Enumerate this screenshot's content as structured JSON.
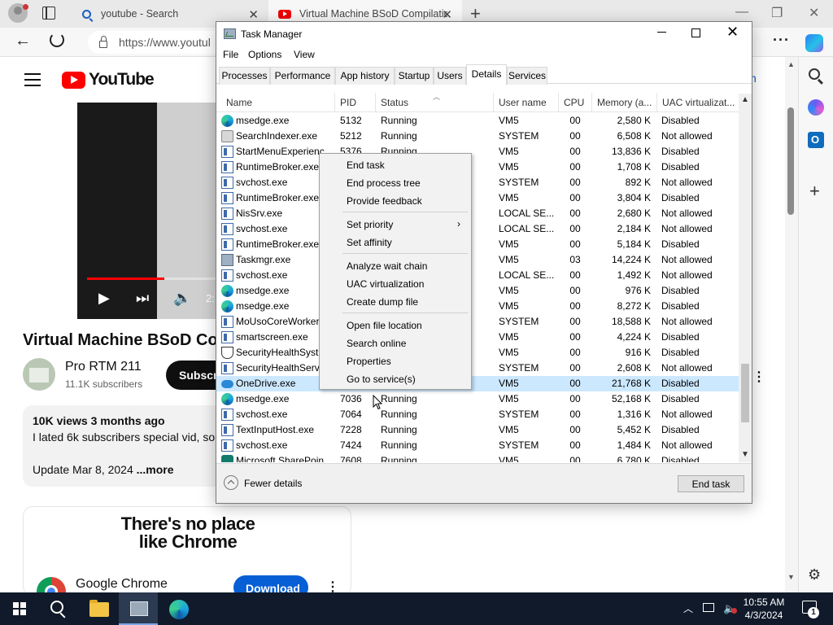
{
  "edge": {
    "tabs": [
      {
        "label": "youtube - Search"
      },
      {
        "label": "Virtual Machine BSoD Compilatio"
      }
    ],
    "new_tab": "+",
    "address": "https://www.youtul"
  },
  "youtube": {
    "logo_text": "YouTube",
    "video_title": "Virtual Machine BSoD Com",
    "time_fragment": "2:",
    "channel_name": "Pro RTM 211",
    "channel_subs": "11.1K subscribers",
    "subscribe_label": "Subscri",
    "views_date": "10K views  3 months ago",
    "description": "I lated 6k subscribers special vid, so",
    "update_text": "Update Mar 8, 2024",
    "more_label": "...more",
    "ad_headline_1": "There's no place",
    "ad_headline_2": "like Chrome",
    "ad_name": "Google Chrome",
    "download_label": "Download",
    "signin_fragment": "n",
    "video_progress": 0.6
  },
  "task_manager": {
    "title": "Task Manager",
    "menu": [
      "File",
      "Options",
      "View"
    ],
    "tabs": [
      {
        "label": "Processes"
      },
      {
        "label": "Performance"
      },
      {
        "label": "App history"
      },
      {
        "label": "Startup"
      },
      {
        "label": "Users"
      },
      {
        "label": "Details"
      },
      {
        "label": "Services"
      }
    ],
    "active_tab": "Details",
    "columns": [
      "Name",
      "PID",
      "Status",
      "User name",
      "CPU",
      "Memory (a...",
      "UAC virtualizat..."
    ],
    "rows": [
      {
        "icon": "edge-icon",
        "name": "msedge.exe",
        "pid": "5132",
        "status": "Running",
        "user": "VM5",
        "cpu": "00",
        "mem": "2,580 K",
        "uac": "Disabled"
      },
      {
        "icon": "search-indexer-icon",
        "name": "SearchIndexer.exe",
        "pid": "5212",
        "status": "Running",
        "user": "SYSTEM",
        "cpu": "00",
        "mem": "6,508 K",
        "uac": "Not allowed"
      },
      {
        "icon": "app-window-icon",
        "name": "StartMenuExperienc",
        "pid": "5376",
        "status": "Running",
        "user": "VM5",
        "cpu": "00",
        "mem": "13,836 K",
        "uac": "Disabled"
      },
      {
        "icon": "app-window-icon",
        "name": "RuntimeBroker.exe",
        "pid": "",
        "status": "",
        "user": "VM5",
        "cpu": "00",
        "mem": "1,708 K",
        "uac": "Disabled"
      },
      {
        "icon": "app-window-icon",
        "name": "svchost.exe",
        "pid": "",
        "status": "",
        "user": "SYSTEM",
        "cpu": "00",
        "mem": "892 K",
        "uac": "Not allowed"
      },
      {
        "icon": "app-window-icon",
        "name": "RuntimeBroker.exe",
        "pid": "",
        "status": "",
        "user": "VM5",
        "cpu": "00",
        "mem": "3,804 K",
        "uac": "Disabled"
      },
      {
        "icon": "app-window-icon",
        "name": "NisSrv.exe",
        "pid": "",
        "status": "",
        "user": "LOCAL SE...",
        "cpu": "00",
        "mem": "2,680 K",
        "uac": "Not allowed"
      },
      {
        "icon": "app-window-icon",
        "name": "svchost.exe",
        "pid": "",
        "status": "",
        "user": "LOCAL SE...",
        "cpu": "00",
        "mem": "2,184 K",
        "uac": "Not allowed"
      },
      {
        "icon": "app-window-icon",
        "name": "RuntimeBroker.exe",
        "pid": "",
        "status": "",
        "user": "VM5",
        "cpu": "00",
        "mem": "5,184 K",
        "uac": "Disabled"
      },
      {
        "icon": "task-manager-icon",
        "name": "Taskmgr.exe",
        "pid": "",
        "status": "",
        "user": "VM5",
        "cpu": "03",
        "mem": "14,224 K",
        "uac": "Not allowed"
      },
      {
        "icon": "app-window-icon",
        "name": "svchost.exe",
        "pid": "",
        "status": "",
        "user": "LOCAL SE...",
        "cpu": "00",
        "mem": "1,492 K",
        "uac": "Not allowed"
      },
      {
        "icon": "edge-icon",
        "name": "msedge.exe",
        "pid": "",
        "status": "",
        "user": "VM5",
        "cpu": "00",
        "mem": "976 K",
        "uac": "Disabled"
      },
      {
        "icon": "edge-icon",
        "name": "msedge.exe",
        "pid": "",
        "status": "",
        "user": "VM5",
        "cpu": "00",
        "mem": "8,272 K",
        "uac": "Disabled"
      },
      {
        "icon": "app-window-icon",
        "name": "MoUsoCoreWorker",
        "pid": "",
        "status": "",
        "user": "SYSTEM",
        "cpu": "00",
        "mem": "18,588 K",
        "uac": "Not allowed"
      },
      {
        "icon": "app-window-icon",
        "name": "smartscreen.exe",
        "pid": "",
        "status": "",
        "user": "VM5",
        "cpu": "00",
        "mem": "4,224 K",
        "uac": "Disabled"
      },
      {
        "icon": "shield-icon",
        "name": "SecurityHealthSystr",
        "pid": "",
        "status": "",
        "user": "VM5",
        "cpu": "00",
        "mem": "916 K",
        "uac": "Disabled"
      },
      {
        "icon": "app-window-icon",
        "name": "SecurityHealthServi",
        "pid": "",
        "status": "",
        "user": "SYSTEM",
        "cpu": "00",
        "mem": "2,608 K",
        "uac": "Not allowed"
      },
      {
        "icon": "onedrive-icon",
        "name": "OneDrive.exe",
        "pid": "",
        "status": "",
        "user": "VM5",
        "cpu": "00",
        "mem": "21,768 K",
        "uac": "Disabled",
        "selected": true
      },
      {
        "icon": "edge-icon",
        "name": "msedge.exe",
        "pid": "7036",
        "status": "Running",
        "user": "VM5",
        "cpu": "00",
        "mem": "52,168 K",
        "uac": "Disabled"
      },
      {
        "icon": "app-window-icon",
        "name": "svchost.exe",
        "pid": "7064",
        "status": "Running",
        "user": "SYSTEM",
        "cpu": "00",
        "mem": "1,316 K",
        "uac": "Not allowed"
      },
      {
        "icon": "app-window-icon",
        "name": "TextInputHost.exe",
        "pid": "7228",
        "status": "Running",
        "user": "VM5",
        "cpu": "00",
        "mem": "5,452 K",
        "uac": "Disabled"
      },
      {
        "icon": "app-window-icon",
        "name": "svchost.exe",
        "pid": "7424",
        "status": "Running",
        "user": "SYSTEM",
        "cpu": "00",
        "mem": "1,484 K",
        "uac": "Not allowed"
      },
      {
        "icon": "sharepoint-icon",
        "name": "Microsoft.SharePoin",
        "pid": "7608",
        "status": "Running",
        "user": "VM5",
        "cpu": "00",
        "mem": "6,780 K",
        "uac": "Disabled"
      }
    ],
    "fewer_details": "Fewer details",
    "end_task": "End task"
  },
  "context_menu": {
    "items": [
      {
        "label": "End task"
      },
      {
        "label": "End process tree"
      },
      {
        "label": "Provide feedback",
        "sep_after": true
      },
      {
        "label": "Set priority",
        "submenu": true
      },
      {
        "label": "Set affinity",
        "sep_after": true
      },
      {
        "label": "Analyze wait chain"
      },
      {
        "label": "UAC virtualization"
      },
      {
        "label": "Create dump file",
        "sep_after": true
      },
      {
        "label": "Open file location"
      },
      {
        "label": "Search online"
      },
      {
        "label": "Properties"
      },
      {
        "label": "Go to service(s)"
      }
    ]
  },
  "taskbar": {
    "time": "10:55 AM",
    "date": "4/3/2024",
    "notification_count": "1"
  }
}
